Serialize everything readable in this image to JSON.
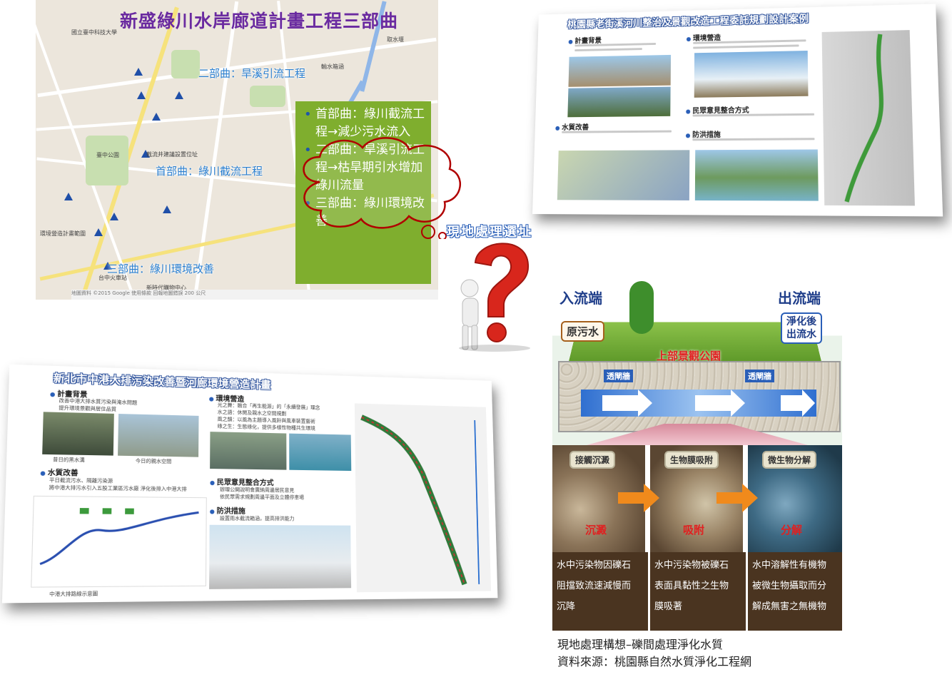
{
  "map": {
    "title": "新盛綠川水岸廊道計畫工程三部曲",
    "part2_label": "二部曲：旱溪引流工程",
    "part1_label": "首部曲：綠川截流工程",
    "part3_label": "三部曲：綠川環境改善",
    "place_labels": [
      "取水堰",
      "輸水箱涵",
      "截流井建議設置位址",
      "環境營造計畫範圍",
      "國立臺中科技大學",
      "臺中公園",
      "台中火車站",
      "新時代購物中心"
    ],
    "attribution": "地圖資料 ©2015 Google   使用條款   回報地圖錯誤   200 公尺",
    "box_items": [
      "首部曲：綠川截流工程→減少污水流入",
      "二部曲：旱溪引流工程→枯旱期引水增加綠川流量",
      "三部曲：綠川環境改善"
    ]
  },
  "question_label": "現地處理選址",
  "doc_taoyuan": {
    "title": "桃園縣老街溪河川整治及景觀改造工程委託規劃設計案例",
    "sections": [
      "計畫背景",
      "環境營造",
      "民眾意見整合方式",
      "水質改善",
      "防洪措施"
    ]
  },
  "doc_newtaipei": {
    "title": "新北市中港大排污染改善暨河廊環境營造計畫",
    "sections": [
      "計畫背景",
      "環境營造",
      "水質改善",
      "民眾意見整合方式",
      "防洪措施"
    ],
    "bg_items": [
      "改善中港大排水質污染與淹水問題",
      "提升環境景觀與居住品質"
    ],
    "photo_captions": [
      "昔日的黑水溝",
      "今日的親水空間"
    ],
    "env_items": [
      "光之舞：融合「再生能源」的「永續發展」理念",
      "水之語：休閒及親水之空間規劃",
      "風之韻：以風為主題導入風鈴與風車裝置藝術",
      "綠之生：生態綠化，提供多樣性物種共生環境"
    ],
    "wq_items": [
      "平日截流污水、隔離污染源",
      "將中港大排污水引入五股工業區污水廠 淨化後排入中港大排"
    ],
    "opinion_items": [
      "辦理公開說明會廣納周邊居民意見",
      "依民眾需求規劃周邊平面及立體停車場"
    ],
    "flood_items": [
      "設置雨水截流箱涵，提高排洪能力"
    ],
    "map_caption": "中港大排路線示意圖"
  },
  "diagram": {
    "inflow": "入流端",
    "outflow": "出流端",
    "raw_sewage": "原污水",
    "treated_outflow": [
      "淨化後",
      "出流水"
    ],
    "park": "上部景觀公園",
    "grate": "透閘牆",
    "stages": [
      {
        "title": "接觸沉澱",
        "word": "沉澱",
        "desc": [
          "水中污染物因礫石",
          "阻擋致流速減慢而",
          "沉降"
        ]
      },
      {
        "title": "生物膜吸附",
        "word": "吸附",
        "desc": [
          "水中污染物被礫石",
          "表面具黏性之生物",
          "膜吸著"
        ]
      },
      {
        "title": "微生物分解",
        "word": "分解",
        "desc": [
          "水中溶解性有機物",
          "被微生物攝取而分",
          "解成無害之無機物"
        ]
      }
    ]
  },
  "caption": {
    "line1": "現地處理構想–礫間處理淨化水質",
    "line2": "資料來源：桃園縣自然水質淨化工程網"
  },
  "colors": {
    "title_purple": "#6a2aa0",
    "box_green": "#7fae2e",
    "label_blue": "#2a7fd0",
    "question_red": "#d8261c"
  }
}
